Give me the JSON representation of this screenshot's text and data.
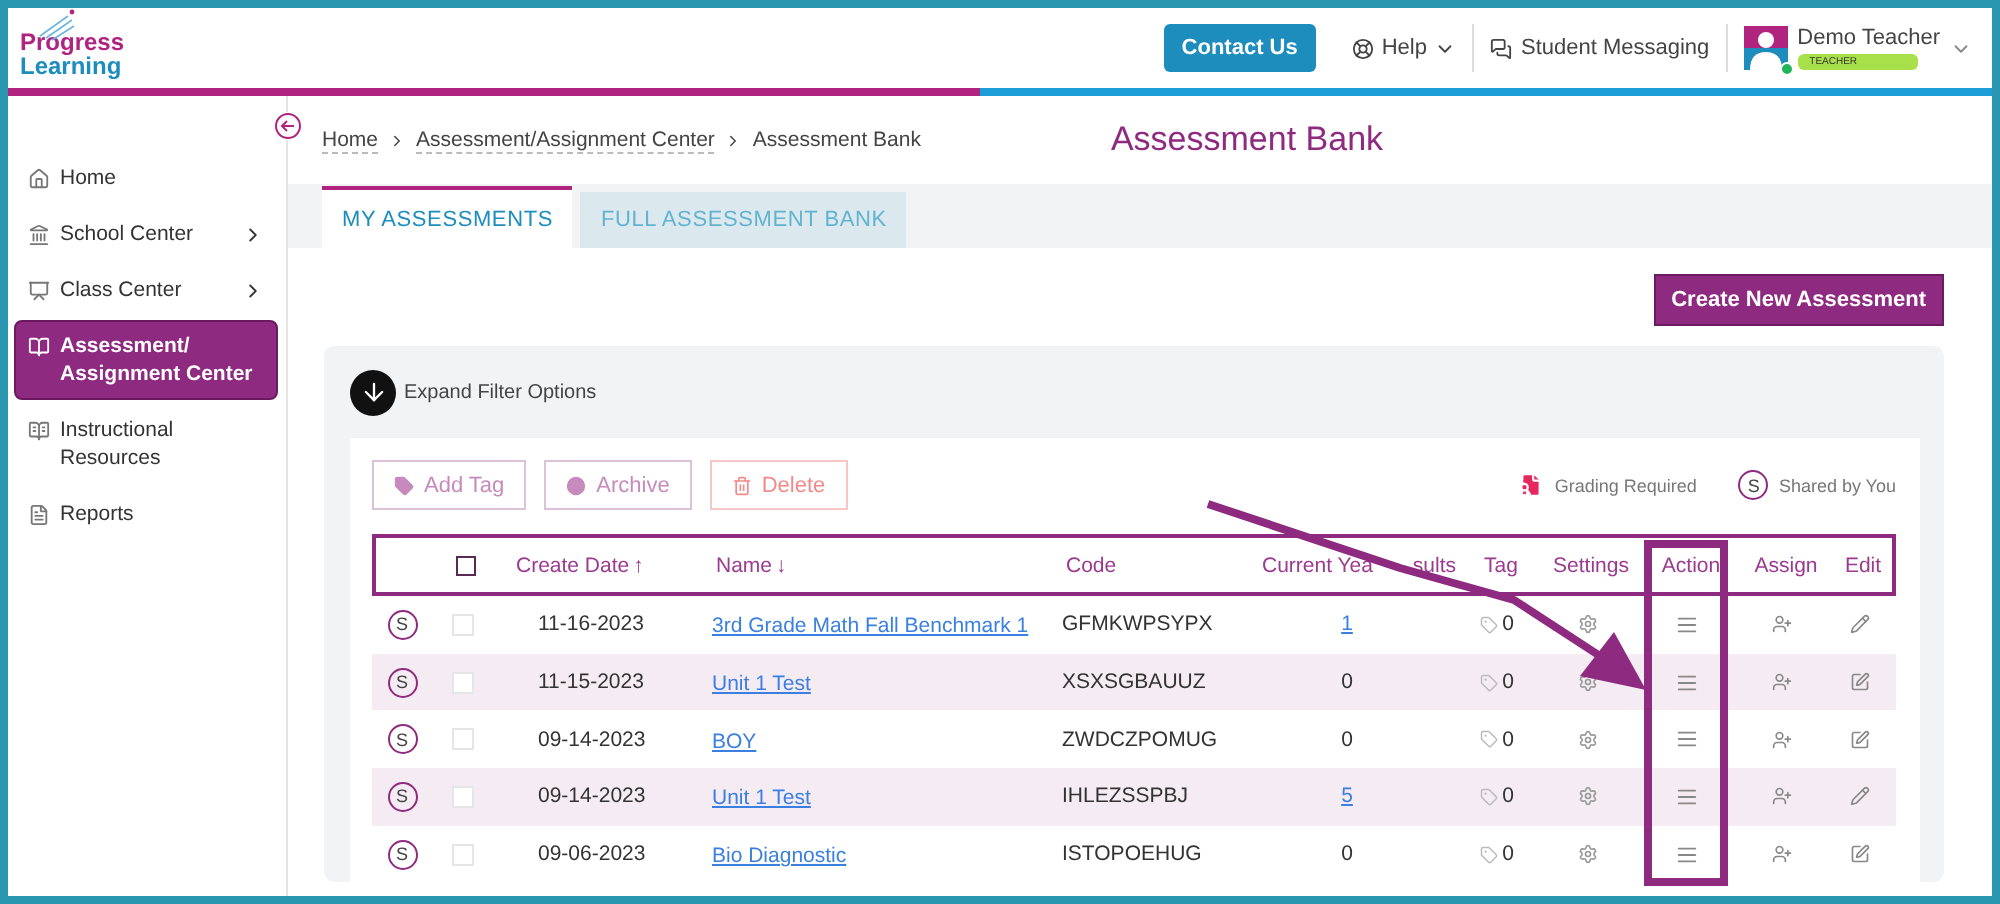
{
  "header": {
    "logo": {
      "line1": "Progress",
      "line2": "Learning"
    },
    "contact_button": "Contact Us",
    "help": "Help",
    "messaging": "Student Messaging",
    "user": {
      "name": "Demo Teacher",
      "role": "TEACHER",
      "online": true
    }
  },
  "sidebar": {
    "items": [
      {
        "kind": "home",
        "label": "Home",
        "expandable": false,
        "selected": false
      },
      {
        "kind": "school",
        "label": "School Center",
        "expandable": true,
        "selected": false
      },
      {
        "kind": "class",
        "label": "Class Center",
        "expandable": true,
        "selected": false
      },
      {
        "kind": "assessment",
        "label": "Assessment/Assignment Center",
        "expandable": false,
        "selected": true
      },
      {
        "kind": "resources",
        "label": "Instructional Resources",
        "expandable": false,
        "selected": false
      },
      {
        "kind": "reports",
        "label": "Reports",
        "expandable": false,
        "selected": false
      }
    ]
  },
  "breadcrumbs": [
    "Home",
    "Assessment/Assignment Center",
    "Assessment Bank"
  ],
  "title": "Assessment Bank",
  "tabs": [
    {
      "label": "MY ASSESSMENTS",
      "selected": true
    },
    {
      "label": "FULL ASSESSMENT BANK",
      "selected": false
    }
  ],
  "create_button": "Create New Assessment",
  "filter_toggle": "Expand Filter Options",
  "toolbar": [
    {
      "kind": "tag",
      "label": "Add Tag"
    },
    {
      "kind": "archive",
      "label": "Archive"
    },
    {
      "kind": "delete",
      "label": "Delete"
    }
  ],
  "legend": [
    {
      "kind": "grading",
      "label": "Grading Required"
    },
    {
      "kind": "shared",
      "badge": "S",
      "label": "Shared by You"
    }
  ],
  "table": {
    "select_all": {
      "checked": false
    },
    "columns": [
      {
        "label": "Create Date",
        "sort_icon": "↑"
      },
      {
        "label": "Name",
        "sort_icon": "↓"
      },
      {
        "label": "Code"
      },
      {
        "label": "Current Yea",
        "label_tail": "sults"
      },
      {
        "label": "Tag"
      },
      {
        "label": "Settings"
      },
      {
        "label": "Action"
      },
      {
        "label": "Assign"
      },
      {
        "label": "Edit"
      }
    ],
    "rows": [
      {
        "badge": "S",
        "checked": false,
        "date": "11-16-2023",
        "name": "3rd Grade Math Fall Benchmark 1",
        "code": "GFMKWPSYPX",
        "results": "1",
        "results_link": true,
        "tags": "0",
        "kind": "pencil"
      },
      {
        "badge": "S",
        "checked": false,
        "date": "11-15-2023",
        "name": "Unit 1 Test",
        "code": "XSXSGBAUUZ",
        "results": "0",
        "results_link": false,
        "tags": "0",
        "kind": "square"
      },
      {
        "badge": "S",
        "checked": false,
        "date": "09-14-2023",
        "name": "BOY",
        "code": "ZWDCZPOMUG",
        "results": "0",
        "results_link": false,
        "tags": "0",
        "kind": "square"
      },
      {
        "badge": "S",
        "checked": false,
        "date": "09-14-2023",
        "name": "Unit 1 Test",
        "code": "IHLEZSSPBJ",
        "results": "5",
        "results_link": true,
        "tags": "0",
        "kind": "pencil"
      },
      {
        "badge": "S",
        "checked": false,
        "date": "09-06-2023",
        "name": "Bio Diagnostic",
        "code": "ISTOPOEHUG",
        "results": "0",
        "results_link": false,
        "tags": "0",
        "kind": "square"
      }
    ]
  }
}
